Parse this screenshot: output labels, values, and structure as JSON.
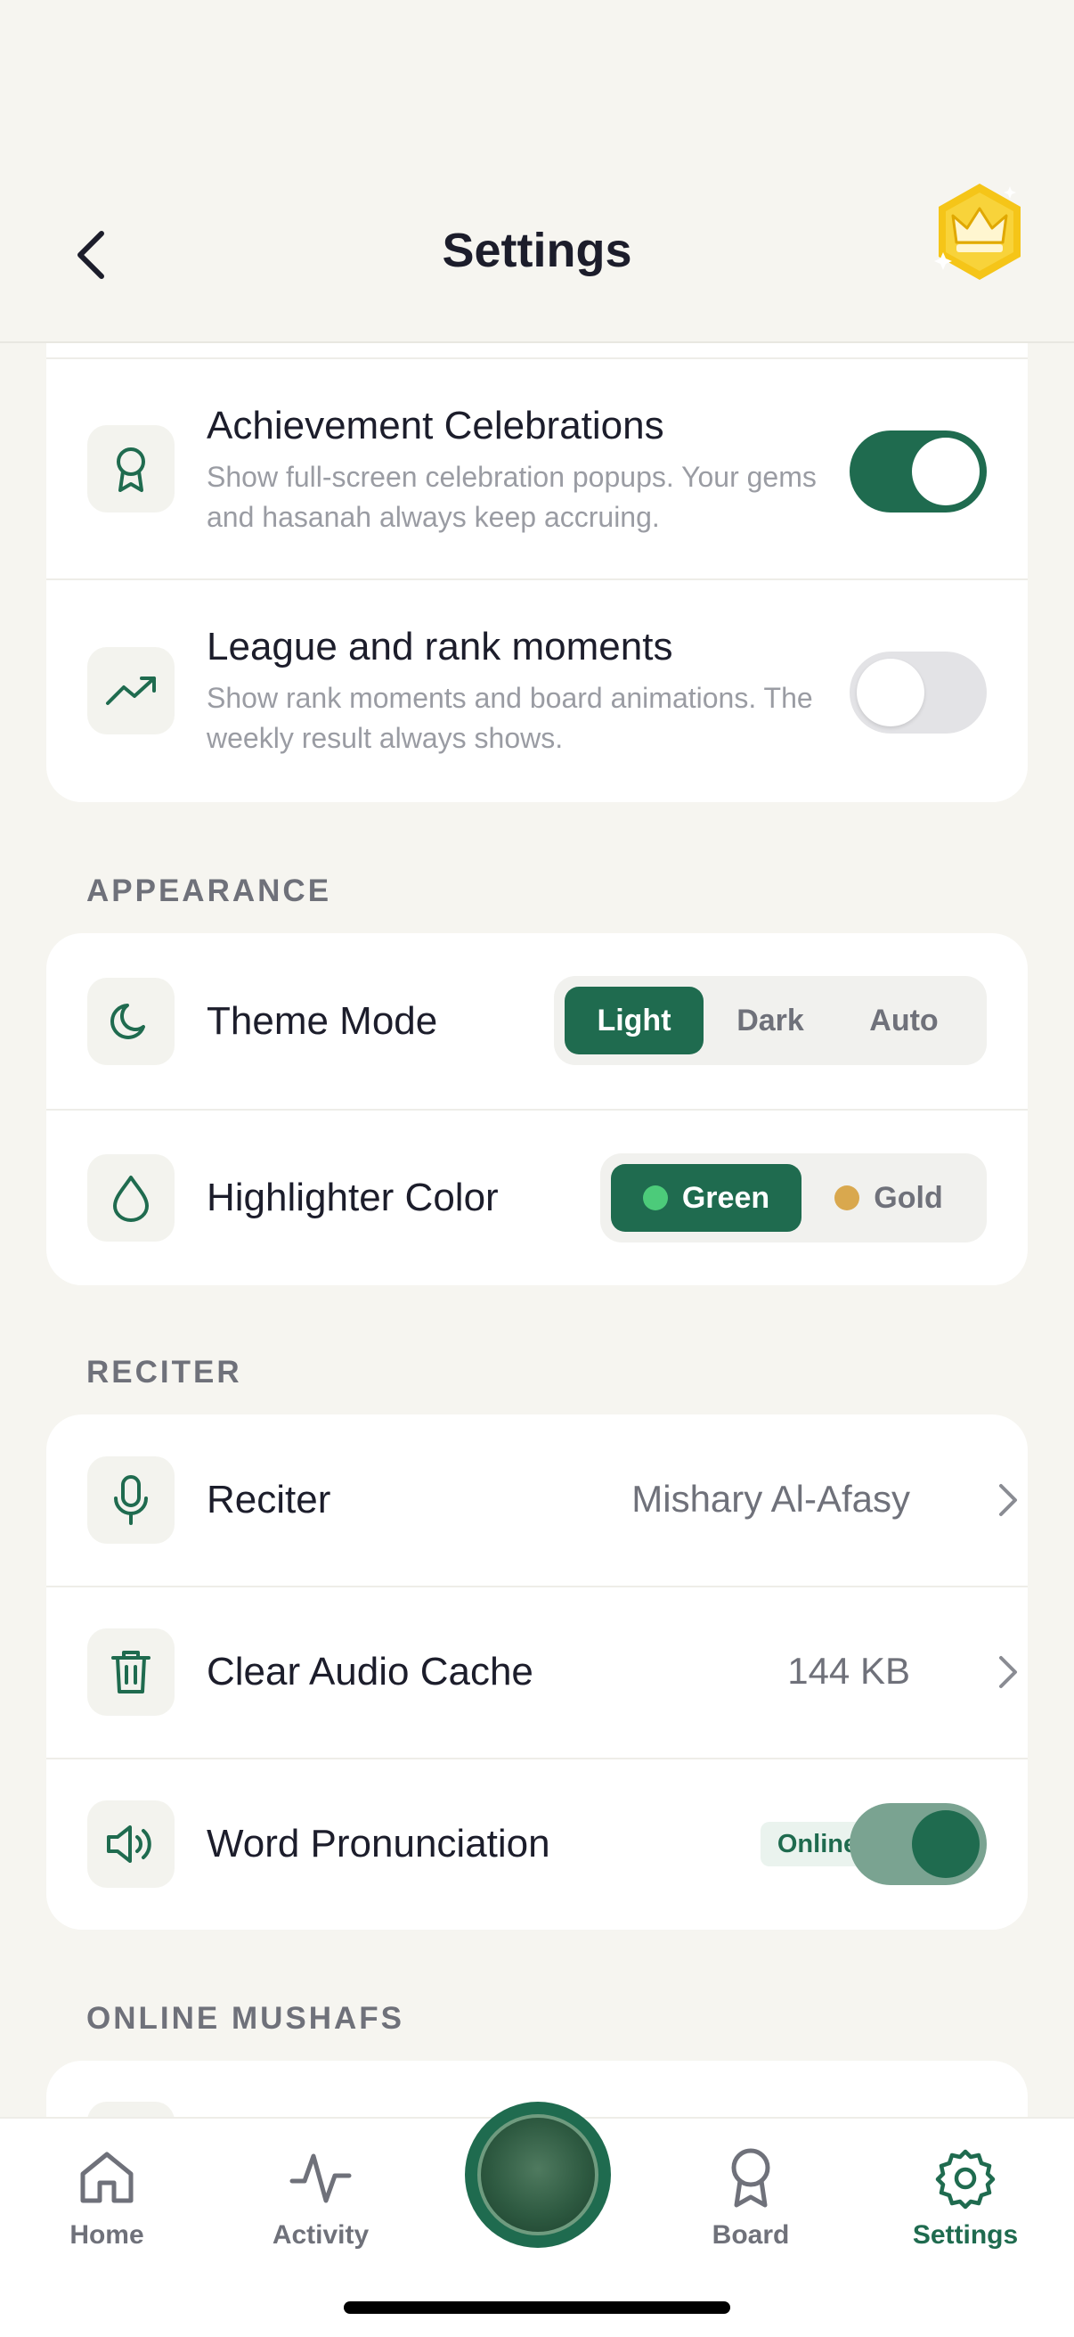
{
  "header": {
    "title": "Settings"
  },
  "notifications_card": {
    "achievement": {
      "title": "Achievement Celebrations",
      "description": "Show full-screen celebration popups. Your gems and hasanah always keep accruing.",
      "enabled": true
    },
    "league": {
      "title": "League and rank moments",
      "description": "Show rank moments and board animations. The weekly result always shows.",
      "enabled": false
    }
  },
  "appearance": {
    "section_label": "APPEARANCE",
    "theme_mode": {
      "title": "Theme Mode",
      "options": [
        "Light",
        "Dark",
        "Auto"
      ],
      "selected": "Light"
    },
    "highlighter_color": {
      "title": "Highlighter Color",
      "options": [
        {
          "label": "Green",
          "color": "#4ccb7a"
        },
        {
          "label": "Gold",
          "color": "#d9a84e"
        }
      ],
      "selected": "Green"
    }
  },
  "reciter": {
    "section_label": "RECITER",
    "reciter_row": {
      "title": "Reciter",
      "value": "Mishary Al-Afasy"
    },
    "cache_row": {
      "title": "Clear Audio Cache",
      "value": "144 KB"
    },
    "pronunciation_row": {
      "title": "Word Pronunciation",
      "badge": "Online",
      "enabled": true
    }
  },
  "online_mushafs": {
    "section_label": "ONLINE MUSHAFS"
  },
  "tabbar": {
    "home": "Home",
    "activity": "Activity",
    "board": "Board",
    "settings": "Settings",
    "active": "Settings"
  },
  "colors": {
    "accent": "#1f6b4f",
    "background": "#f6f5f0",
    "card": "#ffffff",
    "badge_gold": "#f5c518"
  }
}
